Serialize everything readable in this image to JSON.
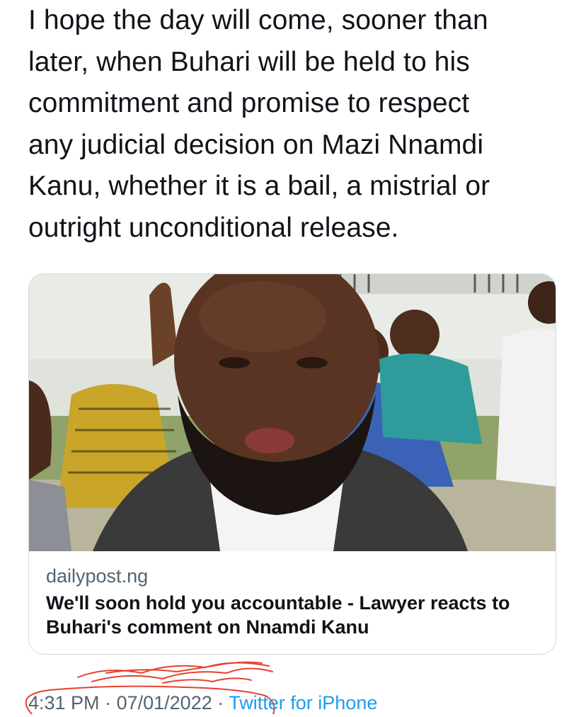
{
  "tweet": {
    "text": "I hope the day will come, sooner than\nlater, when Buhari will be held to his\ncommitment and promise to respect\nany judicial decision on Mazi Nnamdi\nKanu, whether it is a bail, a mistrial or\noutright unconditional release."
  },
  "link_card": {
    "domain": "dailypost.ng",
    "title": "We'll soon hold you accountable - Lawyer reacts to Buhari's comment on Nnamdi Kanu",
    "image_description_icon": "news-photo"
  },
  "meta": {
    "time": "4:31 PM",
    "separator": "·",
    "date": "07/01/2022",
    "source": "Twitter for iPhone"
  },
  "colors": {
    "text": "#0f1419",
    "muted": "#536471",
    "link": "#1d9bf0",
    "border": "#cfd9de",
    "scribble": "#e8402f"
  }
}
